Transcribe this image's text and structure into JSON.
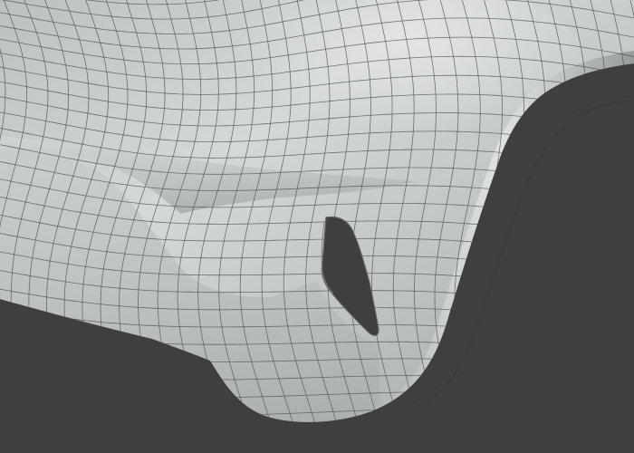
{
  "viewport": {
    "background_color": "#3f3f3f",
    "mesh_base_color": "#a9aeac",
    "mesh_highlight_color": "#e4e7e5",
    "mesh_shadow_color": "#6f7472",
    "wire_color": "#4a4f4d",
    "hole_color": "#3f3f3f"
  },
  "objects": [
    {
      "name": "car-front-bumper-mesh",
      "shading": "solid",
      "wireframe": "on"
    },
    {
      "name": "bumper-vent-opening"
    },
    {
      "name": "wheel-arch-cutout"
    }
  ]
}
